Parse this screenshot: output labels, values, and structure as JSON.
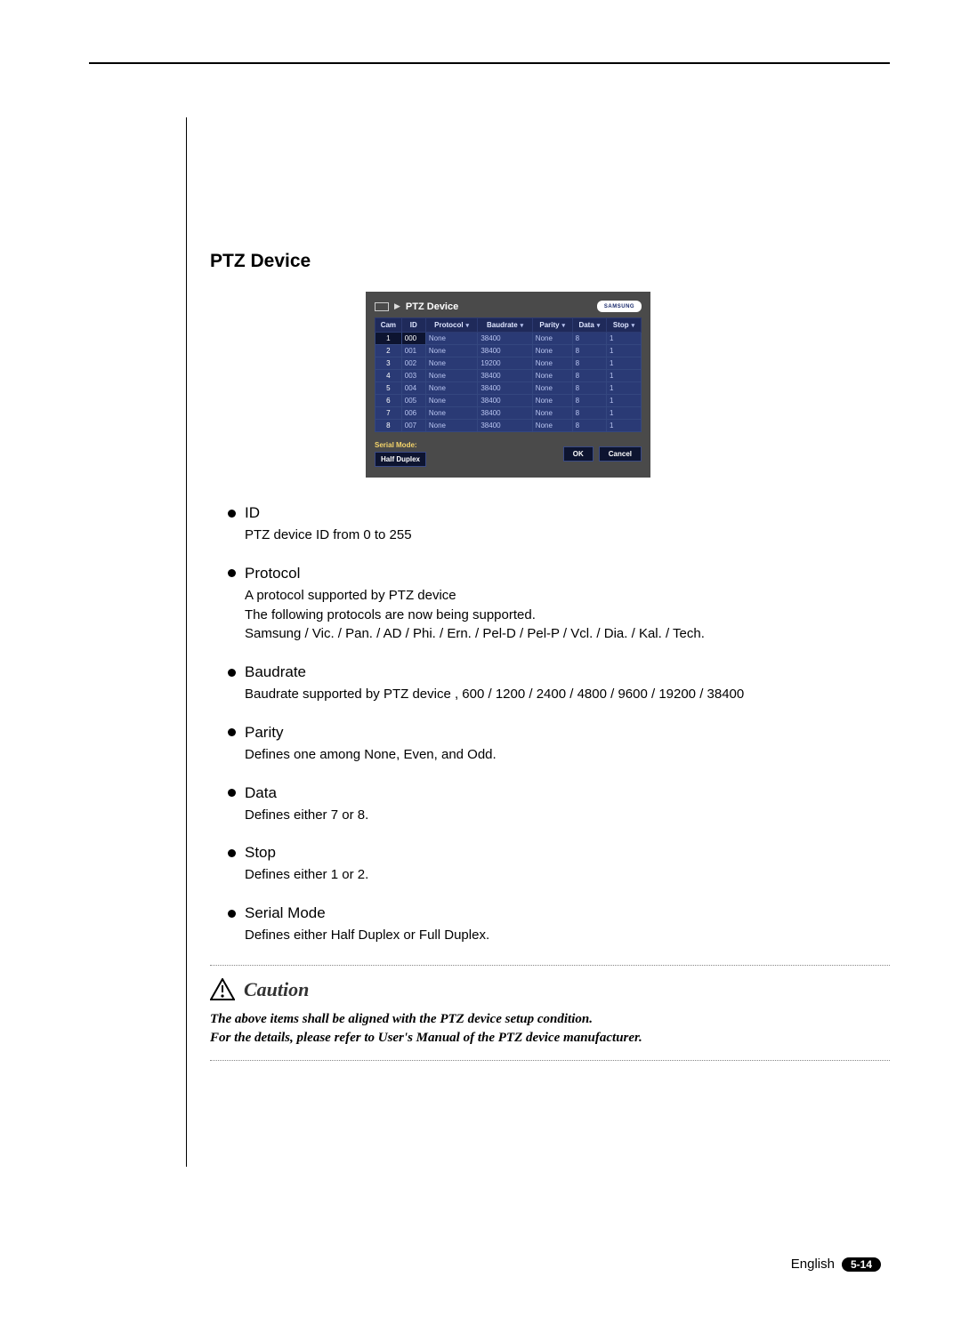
{
  "section": {
    "title": "PTZ Device"
  },
  "panel": {
    "title": "PTZ Device",
    "brand": "SAMSUNG",
    "headers": {
      "cam": "Cam",
      "id": "ID",
      "protocol": "Protocol",
      "baudrate": "Baudrate",
      "parity": "Parity",
      "data": "Data",
      "stop": "Stop"
    },
    "rows": [
      {
        "cam": "1",
        "id": "000",
        "protocol": "None",
        "baudrate": "38400",
        "parity": "None",
        "data": "8",
        "stop": "1"
      },
      {
        "cam": "2",
        "id": "001",
        "protocol": "None",
        "baudrate": "38400",
        "parity": "None",
        "data": "8",
        "stop": "1"
      },
      {
        "cam": "3",
        "id": "002",
        "protocol": "None",
        "baudrate": "19200",
        "parity": "None",
        "data": "8",
        "stop": "1"
      },
      {
        "cam": "4",
        "id": "003",
        "protocol": "None",
        "baudrate": "38400",
        "parity": "None",
        "data": "8",
        "stop": "1"
      },
      {
        "cam": "5",
        "id": "004",
        "protocol": "None",
        "baudrate": "38400",
        "parity": "None",
        "data": "8",
        "stop": "1"
      },
      {
        "cam": "6",
        "id": "005",
        "protocol": "None",
        "baudrate": "38400",
        "parity": "None",
        "data": "8",
        "stop": "1"
      },
      {
        "cam": "7",
        "id": "006",
        "protocol": "None",
        "baudrate": "38400",
        "parity": "None",
        "data": "8",
        "stop": "1"
      },
      {
        "cam": "8",
        "id": "007",
        "protocol": "None",
        "baudrate": "38400",
        "parity": "None",
        "data": "8",
        "stop": "1"
      }
    ],
    "serial_mode_label": "Serial Mode:",
    "serial_mode_value": "Half Duplex",
    "ok": "OK",
    "cancel": "Cancel"
  },
  "items": [
    {
      "label": "ID",
      "desc": "PTZ device  ID from 0 to 255"
    },
    {
      "label": "Protocol",
      "desc": "A protocol supported by PTZ device\nThe following protocols are now being supported.\nSamsung / Vic. / Pan. / AD / Phi. / Ern. / Pel-D / Pel-P / Vcl. / Dia. / Kal. / Tech."
    },
    {
      "label": "Baudrate",
      "desc": "Baudrate supported by PTZ device , 600 / 1200 / 2400 / 4800 / 9600 / 19200 / 38400"
    },
    {
      "label": "Parity",
      "desc": "Defines one among None, Even, and Odd."
    },
    {
      "label": "Data",
      "desc": "Defines either 7 or 8."
    },
    {
      "label": "Stop",
      "desc": "Defines either 1 or 2."
    },
    {
      "label": "Serial Mode",
      "desc": "Defines either Half Duplex or Full Duplex."
    }
  ],
  "caution": {
    "heading": "Caution",
    "body": "The above items shall be aligned with the PTZ device setup condition.\nFor the details, please refer to User's Manual of the PTZ device  manufacturer."
  },
  "footer": {
    "language": "English",
    "page": "5-14"
  }
}
